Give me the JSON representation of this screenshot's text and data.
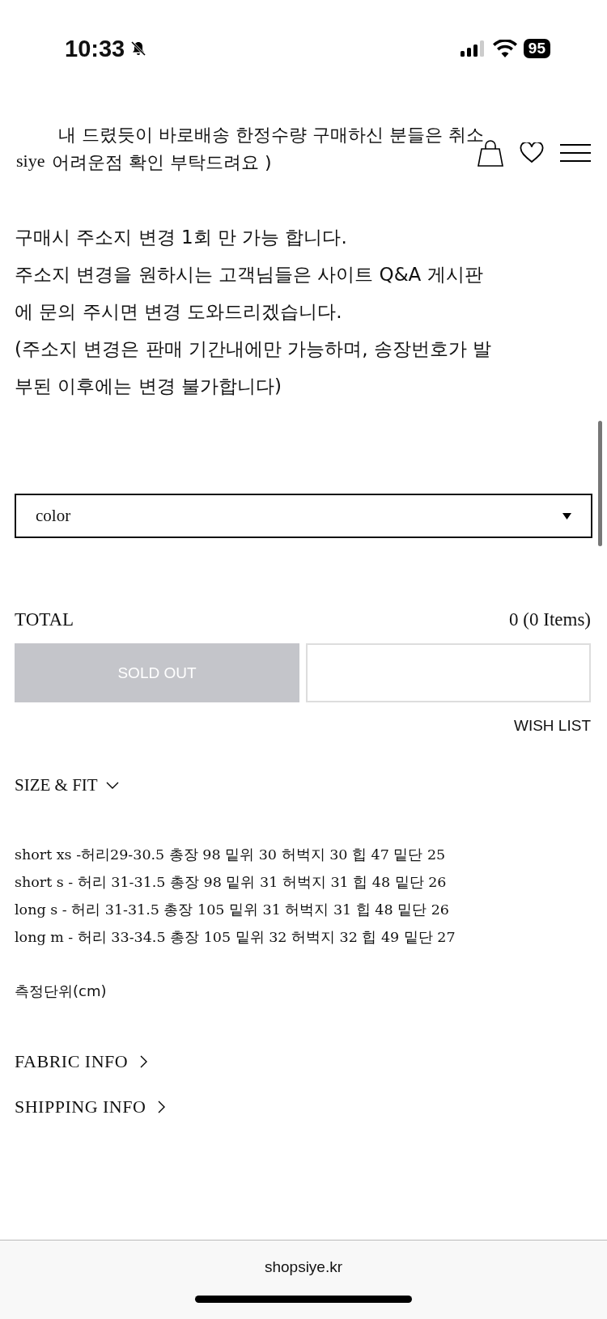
{
  "status_bar": {
    "time": "10:33",
    "battery": "95",
    "silent": true
  },
  "header": {
    "logo": "siye"
  },
  "notice_lines": [
    "내 드렸듯이 바로배송 한정수량 구매하신 분들은 취소",
    "어려운점 확인 부탁드려요 )"
  ],
  "address_notice": [
    "구매시 주소지 변경 1회 만 가능 합니다.",
    "주소지 변경을 원하시는 고객님들은 사이트 Q&A 게시판",
    "에  문의 주시면 변경 도와드리겠습니다.",
    "(주소지 변경은 판매 기간내에만 가능하며, 송장번호가 발",
    "부된 이후에는 변경 불가합니다)"
  ],
  "option_select": {
    "value": "color"
  },
  "total": {
    "label": "TOTAL",
    "value": "0 (0 Items)"
  },
  "buttons": [
    {
      "label": "SOLD OUT",
      "disabled": true
    },
    {
      "disabled": false
    }
  ],
  "wish_list": "WISH LIST",
  "size_fit": {
    "title": "SIZE & FIT",
    "expanded": true,
    "rows": [
      "short xs -허리29-30.5 총장 98 밑위 30 허벅지 30 힙 47 밑단 25",
      "short s - 허리 31-31.5 총장 98 밑위 31 허벅지 31 힙 48 밑단 26",
      "long s - 허리 31-31.5 총장 105 밑위 31 허벅지 31 힙 48 밑단 26",
      "long m - 허리 33-34.5 총장 105 밑위 32 허벅지 32  힙 49 밑단 27"
    ],
    "unit": "측정단위(cm)"
  },
  "info_links": [
    "FABRIC INFO",
    "SHIPPING INFO"
  ],
  "address_bar": {
    "url": "shopsiye.kr"
  }
}
